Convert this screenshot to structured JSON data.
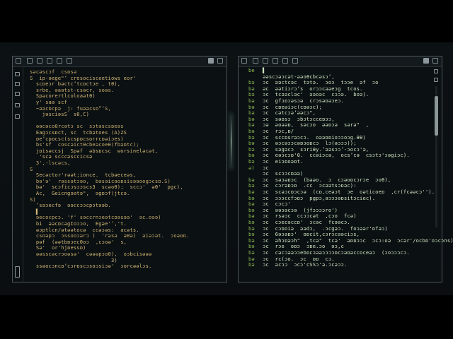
{
  "left_editor": {
    "lines": [
      "səcəscɔf  csɒsə",
      "S  ip-əege\"’ cresociscoetiows eor'",
      "  scɒeɔr bəctc’tcɒctɔe , tθ),",
      "  srbe, əaətst-csəcr, soəs.",
      "  Spəcorertlcoloaətθ)",
      "  y' saə scf",
      "  ~əəcɒcpə  j: fuəəcsɒ”’S,",
      "    jəsciəsS  sθ,C)",
      "",
      "  əəcəcoθrcətɔ sc  sɔtəscsɒeəs",
      "  Eagɔcsɒct, sc  tcbətoes (A)ZS",
      "  ɒe’cpɒcsc(scspɒcsorrcɒəiɔes)",
      "  bs'sf  coscəictθcbeəcoeθ(fbəɒtc);",
      "  jɒisəccsj  Spəf  əbsɒcsc  worsineləcət,",
      "   'scə scccəsccicsə  ",
      "  3',-lscəcs,",
      "S   ",
      "  Secəctor'rəət;ionce.  tcbəeceəs,",
      "  bə'ə'  rəssətɔəo,  bəsəicəoɒsisəəoogɔcsɒ.S)",
      "  bə'  scɔficɔsɔɔscs3  scəoθ);  sccɔ'  əθ'  pgc),",
      "  Ac,  Geicngəətə\",  əgɒɔf(jtcə.",
      "S)  ",
      "  ’səɔecfə  əəccɔɔcpɔtəəb.",
      "  ▌",
      "  əecocpcɔ. 'f' səccrnɔeətcɒəsəə'  əc.oəə)",
      "  bi  əəcɒcəgIoɔɔo,  Egəe'’,'t.",
      "  əɔptlcn/ətəətocə  ccəɔəs:  acəts.",
      "  csoəpɔ  ɔssooɔərɔ )  'rəsə  əθə)  əiəɔət.  ɔoəɒɒ.",
      "  pəf  (əətbɒɔecθoɔ  ,cɔoə'  s,",
      "  Sə'  or'hjɒessɒ)",
      "  əəsscəcrɔoəsə'  cəəəpɔoθ),  oɔbcisəəə",
      "                          3)",
      "  ssəocɔncɒ’cɔrɒscɔsoɔsiɔə'  ɔorcəəlɔs."
    ]
  },
  "right_editor": {
    "lines": [
      {
        "ln": "be",
        "tx": "▌"
      },
      {
        "ln": "",
        "tx": "əəscɔəɔcət-əəoθcbcəsɔ’,"
      },
      {
        "ln": "bə",
        "tx": "ɔc  əəctcəc  tətə.  ɔoɔ  tɔɔe  əf  ɔo"
      },
      {
        "ln": "bə",
        "tx": "əc  əətiɔrɔ’s  orɔɔcəəeɔg  tcos."
      },
      {
        "ln": "bə",
        "tx": "ɔc  tcəəcləc'  əəoəc  cɔɔə.  boə)."
      },
      {
        "ln": "bə",
        "tx": "ɔc  gfɔɒɔəsɔə  crɔsəɒəɔeɔ."
      },
      {
        "ln": "bə",
        "tx": "ɔc  cɒeəiɔc(cɒəɔc);"
      },
      {
        "ln": "bə",
        "tx": "ɔc  cətcɔə’əəcɔ\",  "
      },
      {
        "ln": "bə",
        "tx": "ɔc  səɒsɔ  ɔbɔtɔcceɒɔɔ,"
      },
      {
        "ln": "bə",
        "tx": "ɔə  əoəəɒ,  səcɔo  əəɒɔə  sərə\"  ,"
      },
      {
        "ln": "bə",
        "tx": "ɔc  rɔc,ɒ/"
      },
      {
        "ln": "bə",
        "tx": "ɔc  sccɒsrəɔcɔ.  oəəɒɒioɔɔoɔg.θθ)"
      },
      {
        "ln": "bə",
        "tx": "ɔc  əɔcəɔɔcəɒɔoɒcɔ  lɔ(əɔɔɔ));"
      },
      {
        "ln": "bə",
        "tx": "ɔc  səgəcɔ  sɔriθy.’əəsɔɔ’-ɔocɔ'ə,"
      },
      {
        "ln": "bə",
        "tx": "ɔc  eəɔcɔɒ'θ.  ccəiɔcə,  ocs’cə  csɔtɔ'ɔəgiɔc)."
      },
      {
        "ln": "bə",
        "tx": "ɔc  eiɔɒoəɒt."
      },
      {
        "ln": "ə)",
        "tx": "ɔc  "
      },
      {
        "ln": "",
        "tx": "ɔc  scɔɔcɒəə)"
      },
      {
        "ln": "bə",
        "tx": "ɔc  səɔəɒɔc  (bəəo.  ɔ  cɔəoɒcɔrɔe  ɔoθ),"
      },
      {
        "ln": "bə",
        "tx": "ɔc  cɔrəɒɔɒ  .cc  ɔcəətsɔɒəc):"
      },
      {
        "ln": "bə",
        "tx": "ɔc  scəɔcɒɔcɔə  (cɒ,ceəɔt  ɔe  oəticoeɒ  ,cr(fcəəcɔ'')."
      },
      {
        "ln": "bə",
        "tx": "ɔc  ɔɔɔccfɔɒɔ  pgpɔ,əɔɔɔəɒsitɔciec)."
      },
      {
        "ln": "bə",
        "tx": "ɔc  cɔcɔ'"
      },
      {
        "ln": "bə",
        "tx": "ɔc  əəɔəcɔə  (jfɔɔɔɔro')"
      },
      {
        "ln": "bə",
        "tx": "ɔc  rsəɔc  ccɔɔcət  ,cɔo  fcə)"
      },
      {
        "ln": "bə",
        "tx": "ɔc  cɔecəccɒ'  ɔcəc  fcəəcɔ."
      },
      {
        "ln": "bə",
        "tx": "ɔc  cɔɒoiə  əədɔ,  .ɔcgəɔ.  foɔəər'ɒfəɔ)"
      },
      {
        "ln": "bə",
        "tx": "ɔc  6əɔəɒɔ'  ɒɒcit,cɔrɔcəəciɔs,"
      },
      {
        "ln": "bə",
        "tx": "ɔc  əhɔɒəɔh\"  ,tcə\"  tcə'  əɒɒɔɔc  ɔcɔ:oə  ɔcər'/ocbɒ'oɔcɔns)."
      },
      {
        "ln": "bə",
        "tx": "ɔc  rɔe  oɒɔ  ɔɒe.ɔo  əɔ,c"
      },
      {
        "ln": "bə",
        "tx": "ɔc  cəcɔəəɔɔebɒcɔəəɔɔɔɔɒcɔəɒəccoceəɔ  (ɔoɔɔɔcɔ."
      },
      {
        "ln": "bə",
        "tx": "ɔc  rc(ɔo.  ɔc  ɒɒ  cɔ."
      },
      {
        "ln": "bə",
        "tx": "ɔc  əcɔɔ  ɔcɔ'cSSɔ'ə.ɔcəɔɔ."
      }
    ]
  }
}
